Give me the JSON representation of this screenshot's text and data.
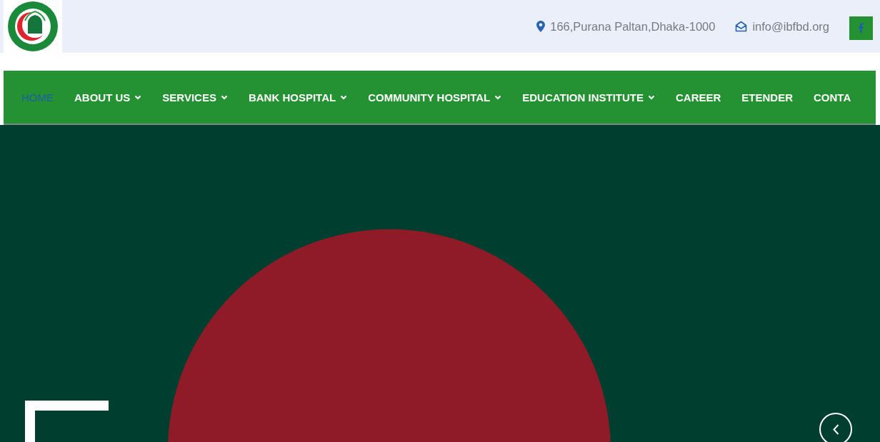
{
  "topbar": {
    "address": "166,Purana Paltan,Dhaka-1000",
    "email": "info@ibfbd.org"
  },
  "nav": {
    "items": [
      {
        "label": "HOME",
        "selected": true,
        "has_dropdown": false
      },
      {
        "label": "ABOUT US",
        "selected": false,
        "has_dropdown": true
      },
      {
        "label": "SERVICES",
        "selected": false,
        "has_dropdown": true
      },
      {
        "label": "BANK HOSPITAL",
        "selected": false,
        "has_dropdown": true
      },
      {
        "label": "COMMUNITY HOSPITAL",
        "selected": false,
        "has_dropdown": true
      },
      {
        "label": "EDUCATION INSTITUTE",
        "selected": false,
        "has_dropdown": true
      },
      {
        "label": "CAREER",
        "selected": false,
        "has_dropdown": false
      },
      {
        "label": "ETENDER",
        "selected": false,
        "has_dropdown": false
      },
      {
        "label": "CONTA",
        "selected": false,
        "has_dropdown": false
      }
    ]
  }
}
